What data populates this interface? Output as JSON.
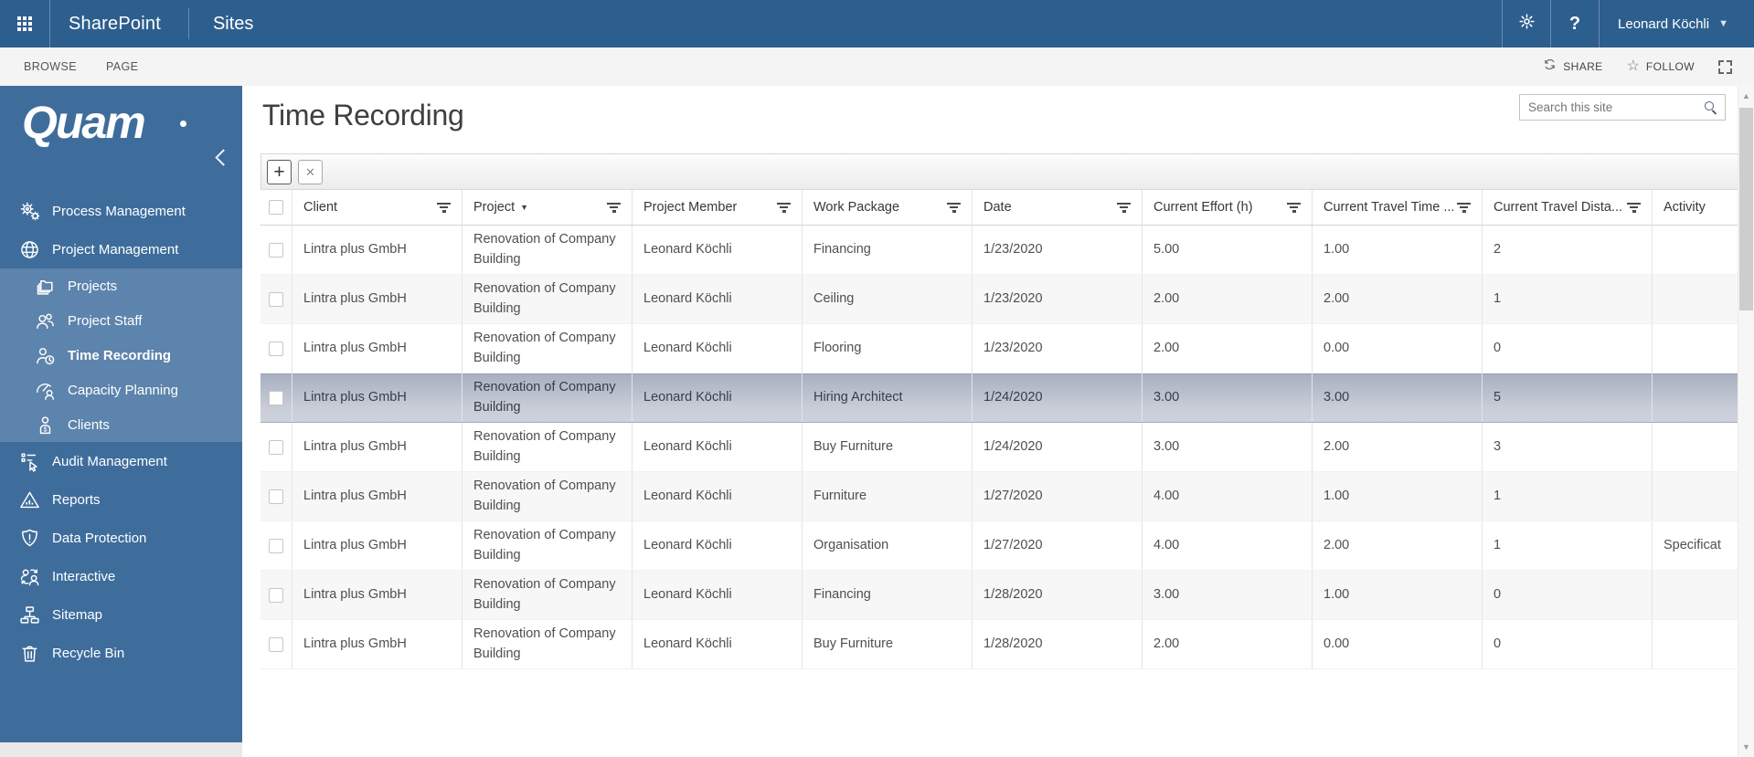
{
  "suite_bar": {
    "app_name": "SharePoint",
    "nav_item": "Sites",
    "user_name": "Leonard Köchli"
  },
  "ribbon": {
    "tabs": [
      {
        "label": "BROWSE"
      },
      {
        "label": "PAGE"
      }
    ],
    "share_label": "SHARE",
    "follow_label": "FOLLOW"
  },
  "sidebar": {
    "logo_text": "Quam",
    "items": [
      {
        "label": "Process Management",
        "icon": "gears-icon",
        "level": 1
      },
      {
        "label": "Project Management",
        "icon": "globe-icon",
        "level": 1
      },
      {
        "label": "Projects",
        "icon": "folders-icon",
        "level": 2
      },
      {
        "label": "Project Staff",
        "icon": "people-icon",
        "level": 2
      },
      {
        "label": "Time Recording",
        "icon": "person-clock-icon",
        "level": 2,
        "active": true
      },
      {
        "label": "Capacity Planning",
        "icon": "gauge-person-icon",
        "level": 2
      },
      {
        "label": "Clients",
        "icon": "client-dollar-icon",
        "level": 2
      },
      {
        "label": "Audit Management",
        "icon": "audit-checklist-icon",
        "level": 1
      },
      {
        "label": "Reports",
        "icon": "report-triangle-icon",
        "level": 1
      },
      {
        "label": "Data Protection",
        "icon": "shield-exclamation-icon",
        "level": 1
      },
      {
        "label": "Interactive",
        "icon": "people-sync-icon",
        "level": 1
      },
      {
        "label": "Sitemap",
        "icon": "sitemap-icon",
        "level": 1
      },
      {
        "label": "Recycle Bin",
        "icon": "trash-icon",
        "level": 1
      }
    ]
  },
  "page": {
    "title": "Time Recording",
    "search_placeholder": "Search this site"
  },
  "toolbar": {
    "add_label": "+",
    "clear_label": "✕"
  },
  "table": {
    "selected_row_index": 3,
    "columns": [
      {
        "label": "",
        "type": "checkbox"
      },
      {
        "label": "Client",
        "filter": true
      },
      {
        "label": "Project",
        "filter": true,
        "sorted": "desc"
      },
      {
        "label": "Project Member",
        "filter": true
      },
      {
        "label": "Work Package",
        "filter": true
      },
      {
        "label": "Date",
        "filter": true
      },
      {
        "label": "Current Effort (h)",
        "filter": true
      },
      {
        "label": "Current Travel Time ...",
        "filter": true
      },
      {
        "label": "Current Travel Dista...",
        "filter": true
      },
      {
        "label": "Activity",
        "filter": false
      }
    ],
    "rows": [
      {
        "client": "Lintra plus GmbH",
        "project": "Renovation of Company Building",
        "member": "Leonard Köchli",
        "work_package": "Financing",
        "date": "1/23/2020",
        "effort": "5.00",
        "travel_time": "1.00",
        "travel_distance": "2",
        "activity": ""
      },
      {
        "client": "Lintra plus GmbH",
        "project": "Renovation of Company Building",
        "member": "Leonard Köchli",
        "work_package": "Ceiling",
        "date": "1/23/2020",
        "effort": "2.00",
        "travel_time": "2.00",
        "travel_distance": "1",
        "activity": ""
      },
      {
        "client": "Lintra plus GmbH",
        "project": "Renovation of Company Building",
        "member": "Leonard Köchli",
        "work_package": "Flooring",
        "date": "1/23/2020",
        "effort": "2.00",
        "travel_time": "0.00",
        "travel_distance": "0",
        "activity": ""
      },
      {
        "client": "Lintra plus GmbH",
        "project": "Renovation of Company Building",
        "member": "Leonard Köchli",
        "work_package": "Hiring Architect",
        "date": "1/24/2020",
        "effort": "3.00",
        "travel_time": "3.00",
        "travel_distance": "5",
        "activity": ""
      },
      {
        "client": "Lintra plus GmbH",
        "project": "Renovation of Company Building",
        "member": "Leonard Köchli",
        "work_package": "Buy Furniture",
        "date": "1/24/2020",
        "effort": "3.00",
        "travel_time": "2.00",
        "travel_distance": "3",
        "activity": ""
      },
      {
        "client": "Lintra plus GmbH",
        "project": "Renovation of Company Building",
        "member": "Leonard Köchli",
        "work_package": "Furniture",
        "date": "1/27/2020",
        "effort": "4.00",
        "travel_time": "1.00",
        "travel_distance": "1",
        "activity": ""
      },
      {
        "client": "Lintra plus GmbH",
        "project": "Renovation of Company Building",
        "member": "Leonard Köchli",
        "work_package": "Organisation",
        "date": "1/27/2020",
        "effort": "4.00",
        "travel_time": "2.00",
        "travel_distance": "1",
        "activity": "Specificat"
      },
      {
        "client": "Lintra plus GmbH",
        "project": "Renovation of Company Building",
        "member": "Leonard Köchli",
        "work_package": "Financing",
        "date": "1/28/2020",
        "effort": "3.00",
        "travel_time": "1.00",
        "travel_distance": "0",
        "activity": ""
      },
      {
        "client": "Lintra plus GmbH",
        "project": "Renovation of Company Building",
        "member": "Leonard Köchli",
        "work_package": "Buy Furniture",
        "date": "1/28/2020",
        "effort": "2.00",
        "travel_time": "0.00",
        "travel_distance": "0",
        "activity": ""
      }
    ]
  },
  "colors": {
    "suite_bar_bg": "#2d5f8e",
    "sidebar_bg": "#3e6d9c",
    "selected_row_top": "#a7afc0",
    "selected_row_bottom": "#ced2dc"
  }
}
